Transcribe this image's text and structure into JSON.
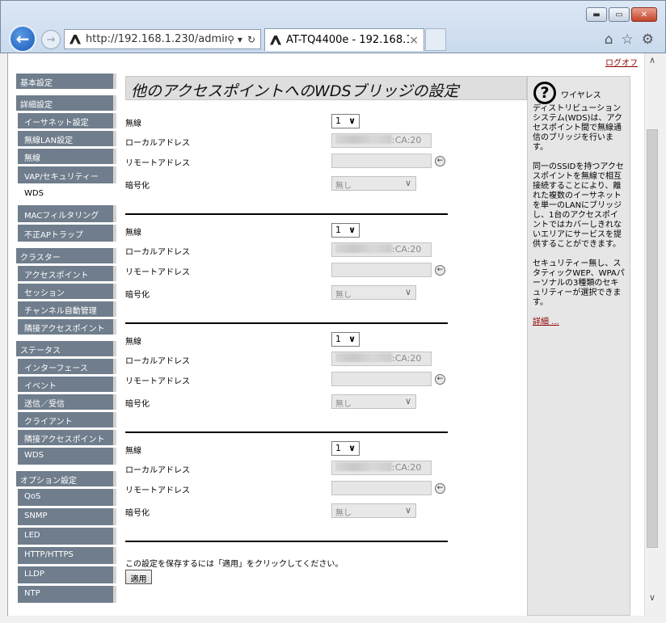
{
  "browser": {
    "url": "http://192.168.1.230/admin",
    "tab_title": "AT-TQ4400e - 192.168.1...",
    "tab_close": "×",
    "addr_search": "⚲ ▾",
    "addr_refresh": "↻",
    "window_minimize": "▬",
    "window_maximize": "▭",
    "window_close": "✕",
    "tools": {
      "home": "⌂",
      "favorites": "☆",
      "settings": "⚙"
    }
  },
  "page": {
    "logout": "ログオフ",
    "title": "他のアクセスポイントへのWDSブリッジの設定"
  },
  "sidebar": {
    "basic_settings": "基本設定",
    "advanced_settings": "詳細設定",
    "advanced_items": [
      "イーサネット設定",
      "無線LAN設定",
      "無線",
      "VAP/セキュリティー",
      "WDS",
      "MACフィルタリング",
      "不正APトラップ"
    ],
    "cluster": "クラスター",
    "cluster_items": [
      "アクセスポイント",
      "セッション",
      "チャンネル自動管理",
      "隣接アクセスポイント"
    ],
    "status": "ステータス",
    "status_items": [
      "インターフェース",
      "イベント",
      "送信／受信",
      "クライアント",
      "隣接アクセスポイント",
      "WDS"
    ],
    "options": "オプション設定",
    "option_items": [
      "QoS",
      "SNMP",
      "LED",
      "HTTP/HTTPS",
      "LLDP",
      "NTP"
    ]
  },
  "wds": {
    "labels": {
      "radio": "無線",
      "local_address": "ローカルアドレス",
      "remote_address": "リモートアドレス",
      "encryption": "暗号化"
    },
    "go_icon": "←",
    "entries": [
      {
        "radio": "1",
        "local_suffix": ":CA:20",
        "remote": "",
        "encryption": "無し"
      },
      {
        "radio": "1",
        "local_suffix": ":CA:20",
        "remote": "",
        "encryption": "無し"
      },
      {
        "radio": "1",
        "local_suffix": ":CA:20",
        "remote": "",
        "encryption": "無し"
      },
      {
        "radio": "1",
        "local_suffix": ":CA:20",
        "remote": "",
        "encryption": "無し"
      }
    ],
    "save_note": "この設定を保存するには「適用」をクリックしてください。",
    "apply_label": "適用"
  },
  "help": {
    "icon": "?",
    "lead": "ワイヤレス",
    "p1": "ディストリビューションシステム(WDS)は、アクセスポイント間で無線通信のブリッジを行います。",
    "p2": "同一のSSIDを持つアクセスポイントを無線で相互接続することにより、離れた複数のイーサネットを単一のLANにブリッジし、1台のアクセスポイントではカバーしきれないエリアにサービスを提供することができます。",
    "p3": "セキュリティー無し、スタティックWEP、WPAパーソナルの3種類のセキュリティーが選択できます。",
    "more": "詳細 ..."
  }
}
